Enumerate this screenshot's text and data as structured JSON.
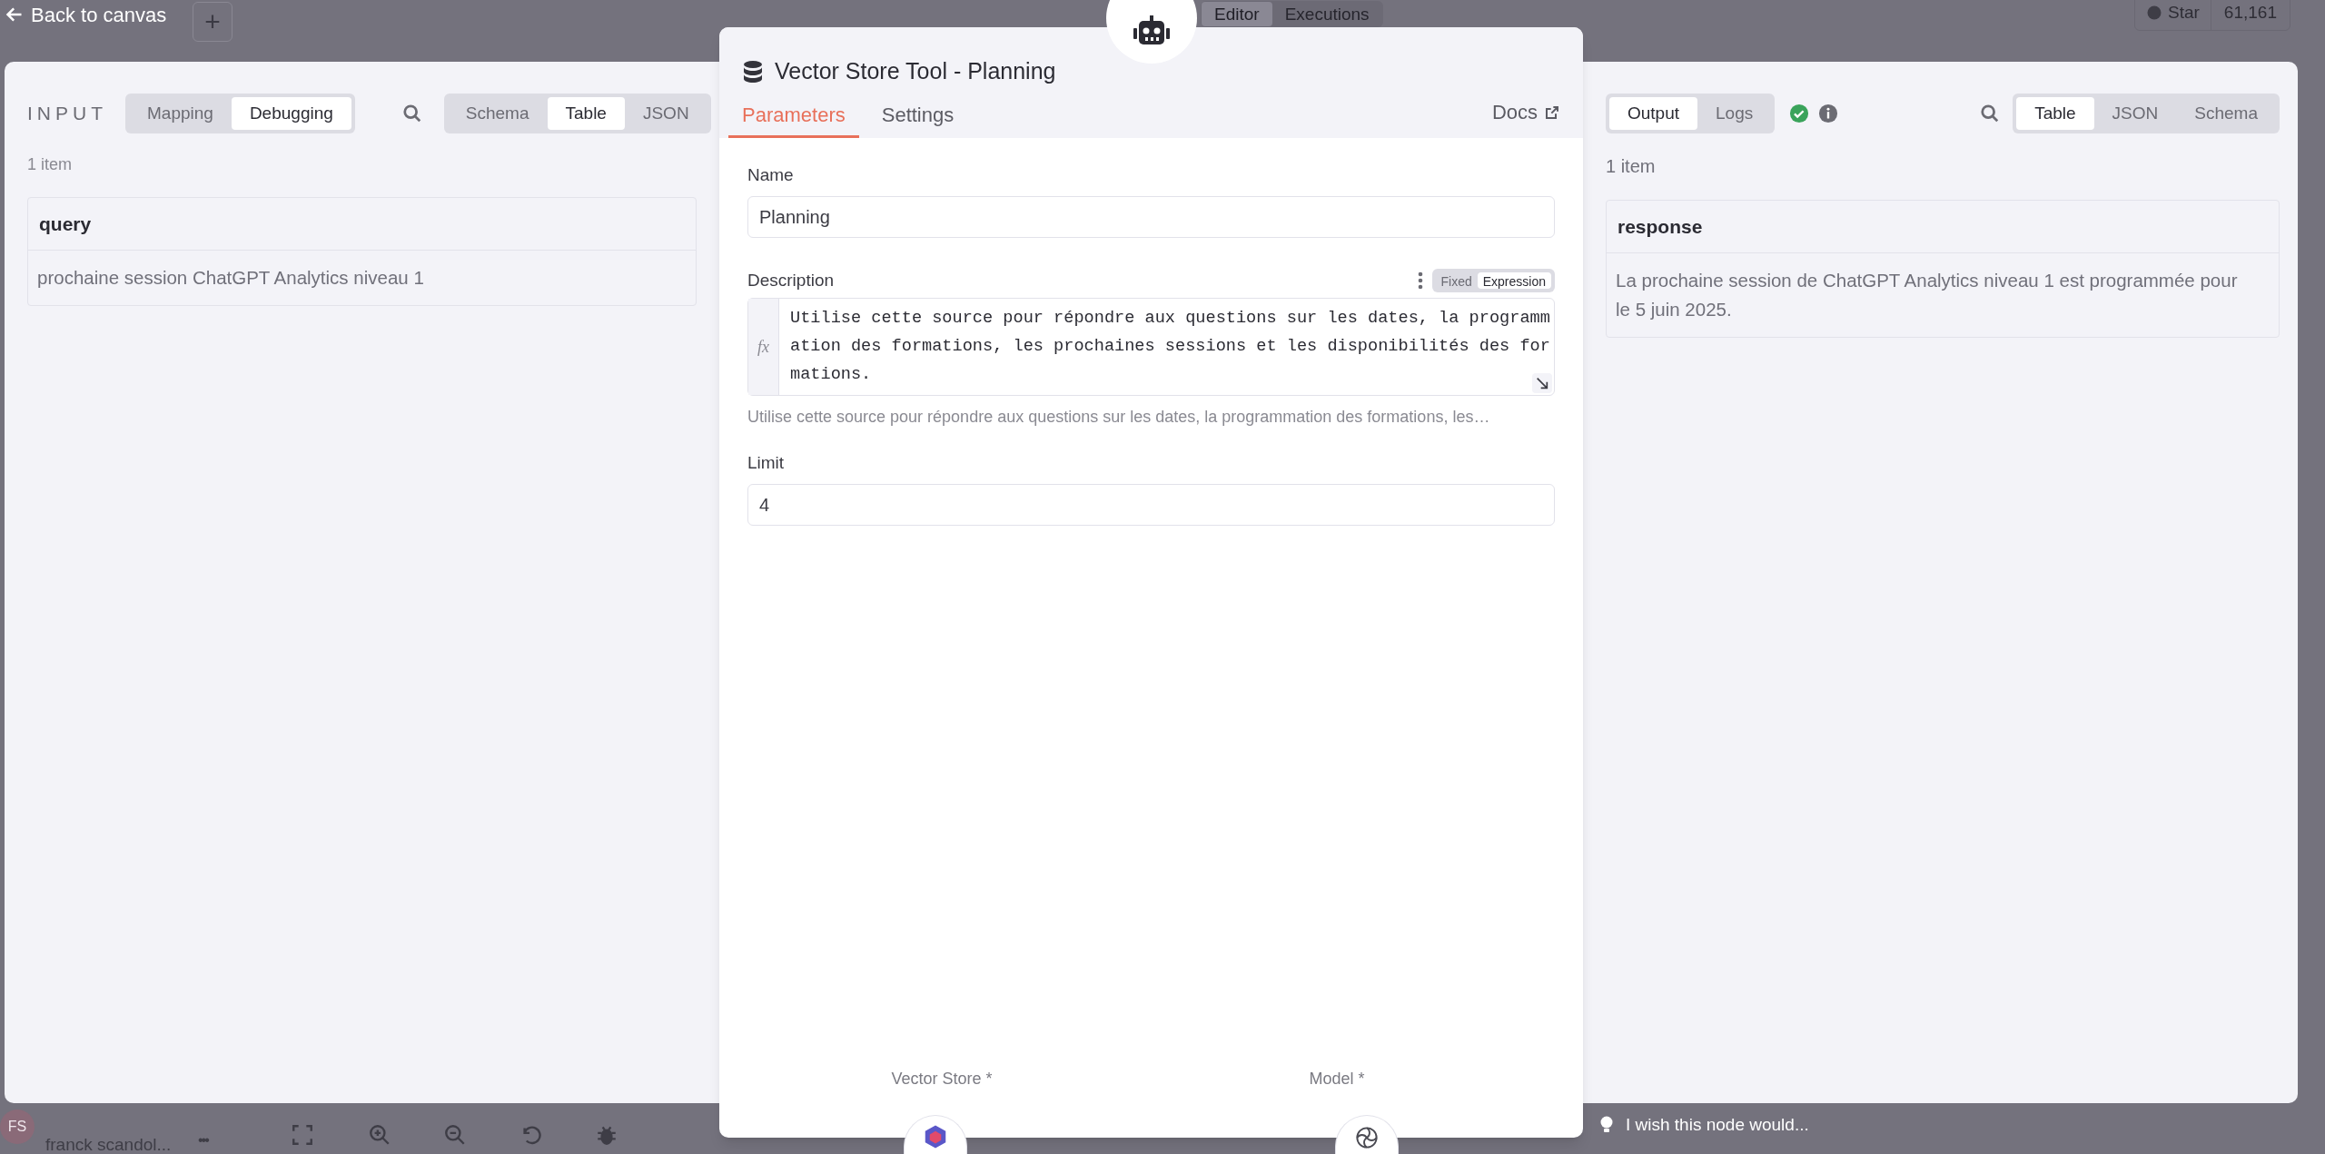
{
  "top_bar": {
    "back": "Back to canvas",
    "add": "+",
    "tabs": [
      {
        "label": "Editor",
        "selected": true
      },
      {
        "label": "Executions",
        "selected": false
      }
    ],
    "star": "Star",
    "star_count": "61,161"
  },
  "input_panel": {
    "title": "INPUT",
    "modes": [
      {
        "label": "Mapping",
        "selected": false
      },
      {
        "label": "Debugging",
        "selected": true
      }
    ],
    "views": [
      {
        "label": "Schema",
        "selected": false
      },
      {
        "label": "Table",
        "selected": true
      },
      {
        "label": "JSON",
        "selected": false
      }
    ],
    "count": "1 item",
    "table": {
      "columns": [
        "query"
      ],
      "rows": [
        [
          "prochaine session ChatGPT Analytics niveau 1"
        ]
      ]
    }
  },
  "node": {
    "title": "Vector Store Tool - Planning",
    "tabs": [
      {
        "label": "Parameters",
        "selected": true
      },
      {
        "label": "Settings",
        "selected": false
      }
    ],
    "docs": "Docs",
    "fields": [
      {
        "kind": "text",
        "label": "Name",
        "value": "Planning"
      },
      {
        "kind": "expression",
        "label": "Description",
        "modes": [
          {
            "label": "Fixed",
            "selected": false
          },
          {
            "label": "Expression",
            "selected": true
          }
        ],
        "gutter": "fx",
        "value": "Utilise cette source pour répondre aux questions sur les dates, la programmation des formations, les prochaines sessions et les disponibilités des formations.",
        "hint": "Utilise cette source pour répondre aux questions sur les dates, la programmation des formations, les…"
      },
      {
        "kind": "text",
        "label": "Limit",
        "value": "4"
      }
    ],
    "connectors": [
      {
        "label": "Vector Store *"
      },
      {
        "label": "Model *"
      }
    ]
  },
  "output_panel": {
    "modes": [
      {
        "label": "Output",
        "selected": true
      },
      {
        "label": "Logs",
        "selected": false
      }
    ],
    "success": true,
    "views": [
      {
        "label": "Table",
        "selected": true
      },
      {
        "label": "JSON",
        "selected": false
      },
      {
        "label": "Schema",
        "selected": false
      }
    ],
    "count": "1 item",
    "table": {
      "columns": [
        "response"
      ],
      "rows": [
        [
          "La prochaine session de ChatGPT Analytics niveau 1 est programmée pour le 5 juin 2025."
        ]
      ]
    }
  },
  "bottom_bar": {
    "initials": "FS",
    "user": "franck scandol...",
    "more": "•••"
  },
  "feedback": "I wish this node would..."
}
